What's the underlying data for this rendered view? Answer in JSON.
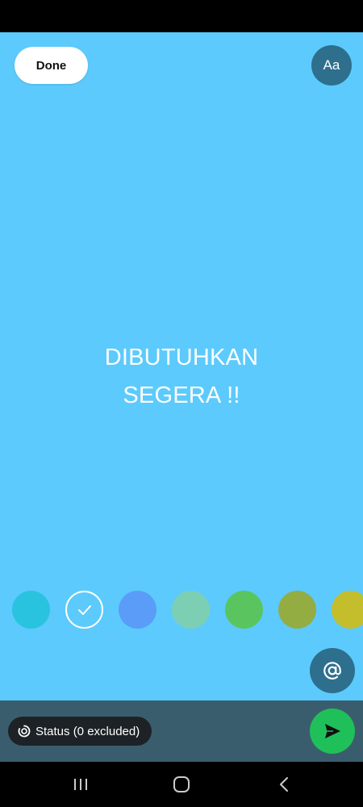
{
  "app": {
    "background_color": "#5ccafc"
  },
  "header": {
    "done_label": "Done",
    "font_button_label": "Aa"
  },
  "status": {
    "lines": [
      "DIBUTUHKAN",
      "SEGERA !!"
    ]
  },
  "color_palette": {
    "colors": [
      "#29c3e0",
      "#5ccafc",
      "#5b9cf9",
      "#7dcfb4",
      "#5ac55e",
      "#93ad43",
      "#c4bd2c"
    ],
    "selected_index": 1
  },
  "icons": {
    "mention": "at-sign-icon",
    "send": "send-icon",
    "audience": "status-ring-icon",
    "selected": "checkmark-icon"
  },
  "footer": {
    "audience_label": "Status (0 excluded)"
  },
  "navigation": {
    "recent": "recent-apps-icon",
    "home": "home-icon",
    "back": "back-icon"
  }
}
